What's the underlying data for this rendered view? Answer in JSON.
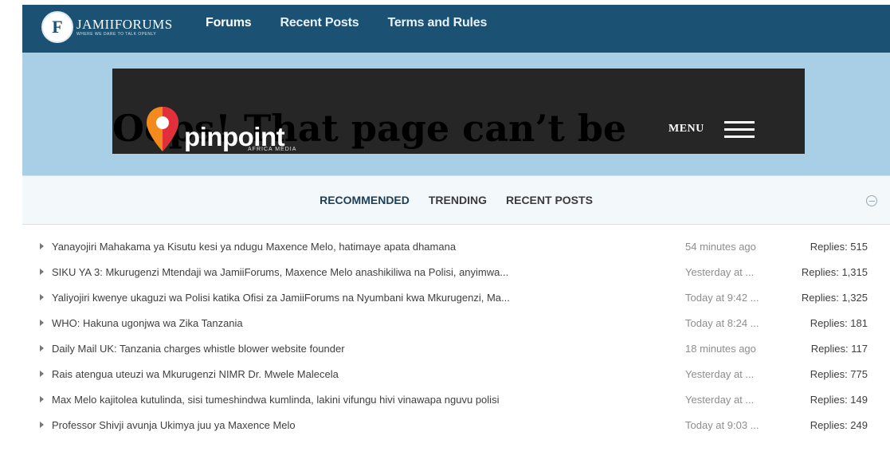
{
  "header": {
    "logo_letter": "F",
    "logo_text": "JAMIIFORUMS",
    "logo_tagline": "WHERE WE DARE TO TALK OPENLY",
    "nav": [
      {
        "label": "Forums"
      },
      {
        "label": "Recent Posts"
      },
      {
        "label": "Terms and Rules"
      }
    ]
  },
  "ad": {
    "ghost_text": "Oops! That page can’t be",
    "brand": "pinpoint",
    "brand_sub": "AFRICA MEDIA",
    "menu_label": "MENU"
  },
  "tabs": [
    {
      "label": "RECOMMENDED",
      "active": true
    },
    {
      "label": "TRENDING",
      "active": false
    },
    {
      "label": "RECENT POSTS",
      "active": false
    }
  ],
  "threads": [
    {
      "title": "Yanayojiri Mahakama ya Kisutu kesi ya ndugu Maxence Melo, hatimaye apata dhamana",
      "time": "54 minutes ago",
      "replies": "Replies: 515"
    },
    {
      "title": "SIKU YA 3: Mkurugenzi Mtendaji wa JamiiForums, Maxence Melo anashikiliwa na Polisi, anyimwa...",
      "time": "Yesterday at ...",
      "replies": "Replies: 1,315"
    },
    {
      "title": "Yaliyojiri kwenye ukaguzi wa Polisi katika Ofisi za JamiiForums na Nyumbani kwa Mkurugenzi, Ma...",
      "time": "Today at 9:42 ...",
      "replies": "Replies: 1,325"
    },
    {
      "title": "WHO: Hakuna ugonjwa wa Zika Tanzania",
      "time": "Today at 8:24 ...",
      "replies": "Replies: 181"
    },
    {
      "title": "Daily Mail UK: Tanzania charges whistle blower website founder",
      "time": "18 minutes ago",
      "replies": "Replies: 117"
    },
    {
      "title": "Rais atengua uteuzi wa Mkurugenzi NIMR Dr. Mwele Malecela",
      "time": "Yesterday at ...",
      "replies": "Replies: 775"
    },
    {
      "title": "Max Melo kajitolea kutulinda, sisi tumeshindwa kumlinda, lakini vifungu hivi vinawapa nguvu polisi",
      "time": "Yesterday at ...",
      "replies": "Replies: 149"
    },
    {
      "title": "Professor Shivji avunja Ukimya juu ya Maxence Melo",
      "time": "Today at 9:03 ...",
      "replies": "Replies: 249"
    }
  ],
  "colors": {
    "topbar": "#1b5173",
    "background": "#a9cfe6",
    "ad_background": "#262626",
    "pin_orange": "#f28a1e",
    "pin_red": "#e2303a"
  }
}
